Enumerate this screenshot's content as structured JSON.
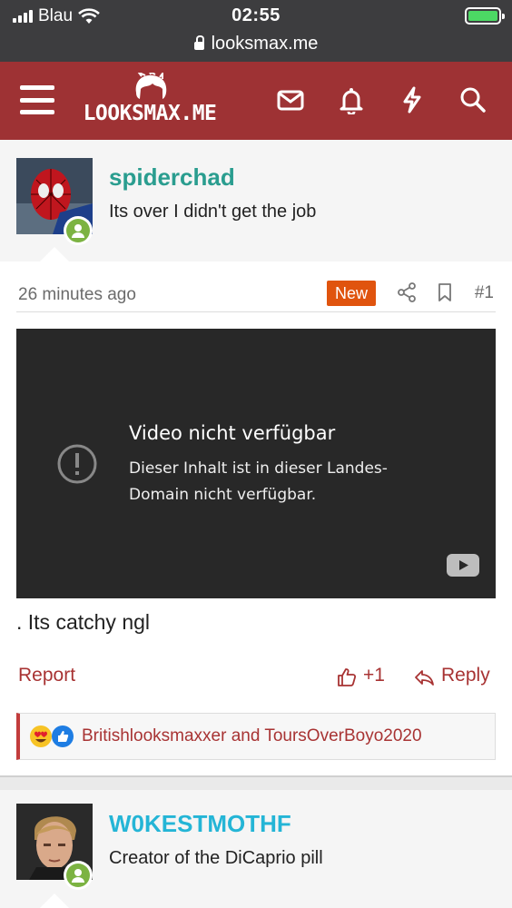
{
  "status_bar": {
    "carrier": "Blau",
    "time": "02:55",
    "url": "looksmax.me"
  },
  "header": {
    "logo_text": "LOOKSMAX.ME",
    "icons": [
      "menu-icon",
      "mail-icon",
      "bell-icon",
      "lightning-icon",
      "search-icon"
    ],
    "colors": {
      "brand": "#9e3234"
    }
  },
  "thread_starter": {
    "username": "spiderchad",
    "username_color": "#2a9d8f",
    "title_text": "Its over I didn't get the job"
  },
  "post": {
    "time": "26 minutes ago",
    "badge": "New",
    "badge_color": "#e0540e",
    "number": "#1",
    "video": {
      "title": "Video nicht verfügbar",
      "message": "Dieser Inhalt ist in dieser Landes-Domain nicht verfügbar."
    },
    "text": ". Its catchy ngl",
    "report_label": "Report",
    "like_count": "+1",
    "reply_label": "Reply",
    "reactions_text": "Britishlooksmaxxer and ToursOverBoyo2020"
  },
  "next_user": {
    "username": "W0KESTMOTHF",
    "username_color": "#24b5d6",
    "title_text": "Creator of the DiCaprio pill"
  }
}
